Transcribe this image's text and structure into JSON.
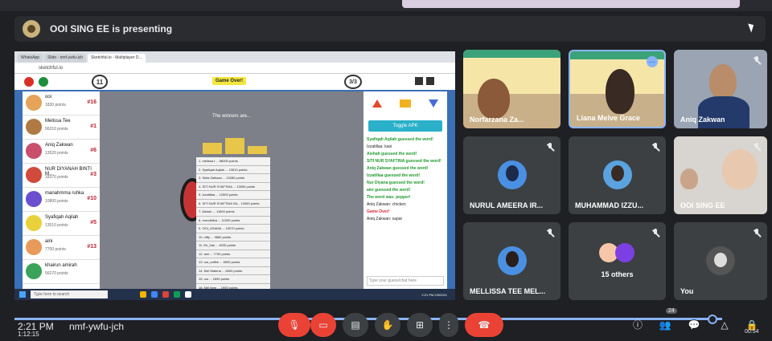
{
  "header": {
    "presenter_text": "OOI SING EE is presenting"
  },
  "shared_screen": {
    "browser_tabs": [
      "WhatsApp",
      "Slido - nmf-ywfu-jch",
      "Sketchful.io - Multiplayer D..."
    ],
    "address": "sketchful.io",
    "round_left": "11",
    "round_right": "3/3",
    "game_over": "Game Over!",
    "winners_title": "The winners are...",
    "players": [
      {
        "name": "ooi",
        "points": "1830 points",
        "rank": "#16",
        "color": "#e7a35a"
      },
      {
        "name": "Melissa Tee",
        "points": "56310 points",
        "rank": "#1",
        "color": "#b07a45"
      },
      {
        "name": "Aniq Zakwan",
        "points": "13520 points",
        "rank": "#6",
        "color": "#c94f6d"
      },
      {
        "name": "NUR DIYANAH BINTI M...",
        "points": "18370 points",
        "rank": "#3",
        "color": "#d04b3b"
      },
      {
        "name": "manahmma ruhka",
        "points": "10800 points",
        "rank": "#10",
        "color": "#6b4fd0"
      },
      {
        "name": "Syafiqah Aqilah",
        "points": "13510 points",
        "rank": "#5",
        "color": "#e8d13a"
      },
      {
        "name": "aini",
        "points": "7700 points",
        "rank": "#13",
        "color": "#e89a5a"
      },
      {
        "name": "khairun amirah",
        "points": "56270 points",
        "rank": "",
        "color": "#3aa35a"
      }
    ],
    "scores": [
      "1. melissa t ... 56000 points",
      "2. Syafiqah Aqilah ... 13510 points",
      "3. Seila Zalhaza ... 13280 points",
      "4. SITI NUR SYAFTINA ... 13050 points",
      "5. Izzatillaa ... 12500 points",
      "6. SITI NUR SYAFTINA SA... 12050 points",
      "7. Aishah ... 11600 points",
      "8. nurudidina ... 11000 points",
      "9. OOI_USAMA ... 10070 points",
      "10. nifty ... 9680 points",
      "11. Mr_Zak ... 8230 points",
      "12. aini ... 7700 points",
      "13. ooi_coffee ... 6500 points",
      "14. Mel Watena ... 6500 points",
      "15. ooi ... 1830 points",
      "16. Mel farm ... 1900 points",
      "17. this farm of ooianaruo ... 0 points"
    ],
    "toggle_apk": "Toggle APK",
    "chat": [
      {
        "text": "Syafiqah Aqilah guessed the word!",
        "style": "green"
      },
      {
        "text": "Izzatillaa: kaoi",
        "style": "dark"
      },
      {
        "text": "Aishah guessed the word!",
        "style": "green"
      },
      {
        "text": "SITI NUR SYAFTINA guessed the word!",
        "style": "green"
      },
      {
        "text": "Aniq Zakwan guessed the word!",
        "style": "green"
      },
      {
        "text": "Izzatillaa guessed the word!",
        "style": "green"
      },
      {
        "text": "Nur Diyana guessed the word!",
        "style": "green"
      },
      {
        "text": "aini guessed the word!",
        "style": "green"
      },
      {
        "text": "The word was: pepper!",
        "style": "green"
      },
      {
        "text": "Aniq Zakwan: chicken",
        "style": "dark"
      },
      {
        "text": "Game Over!",
        "style": "red"
      },
      {
        "text": "Aniq Zakwan: sapar",
        "style": "dark"
      }
    ],
    "chat_placeholder": "Type your guess/chat here",
    "taskbar_search": "Type here to search",
    "taskbar_clock": "2:21 PM 2/5/2021"
  },
  "tiles": [
    {
      "name": "Norfarzana Za...",
      "kind": "video"
    },
    {
      "name": "Liana Melve Grace",
      "kind": "video"
    },
    {
      "name": "Aniq Zakwan",
      "kind": "video"
    },
    {
      "name": "NURUL AMEERA IR...",
      "kind": "avatar"
    },
    {
      "name": "MUHAMMAD IZZU...",
      "kind": "avatar"
    },
    {
      "name": "OOI SING EE",
      "kind": "video"
    },
    {
      "name": "MELLISSA TEE MEL...",
      "kind": "avatar"
    },
    {
      "name": "15 others",
      "kind": "others"
    },
    {
      "name": "You",
      "kind": "self"
    }
  ],
  "bottom_bar": {
    "time": "2:21 PM",
    "elapsed": "1:12:15",
    "meeting_code": "nmf-ywfu-jch",
    "remaining": "00:54",
    "people_count": "24"
  },
  "colors": {
    "red_button": "#ea4335",
    "accent_blue": "#8ab4f8",
    "tile_bg": "#3c4043"
  }
}
